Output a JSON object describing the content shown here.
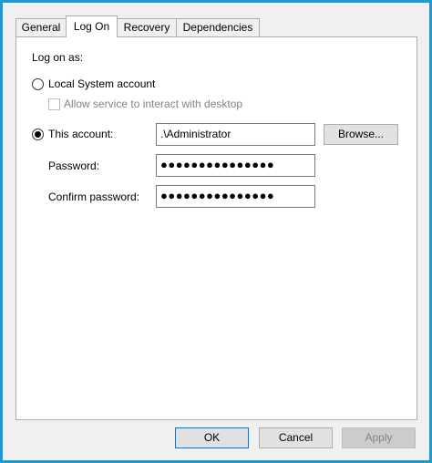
{
  "tabs": [
    {
      "label": "General"
    },
    {
      "label": "Log On"
    },
    {
      "label": "Recovery"
    },
    {
      "label": "Dependencies"
    }
  ],
  "logon": {
    "section_label": "Log on as:",
    "local_system_label": "Local System account",
    "interact_label": "Allow service to interact with desktop",
    "this_account_label": "This account:",
    "account_value": ".\\Administrator",
    "browse_label": "Browse...",
    "password_label": "Password:",
    "password_value": "●●●●●●●●●●●●●●●",
    "confirm_label": "Confirm password:",
    "confirm_value": "●●●●●●●●●●●●●●●"
  },
  "footer": {
    "ok_label": "OK",
    "cancel_label": "Cancel",
    "apply_label": "Apply"
  },
  "colors": {
    "frame": "#1c9ad6",
    "default_button_border": "#0078d7"
  }
}
